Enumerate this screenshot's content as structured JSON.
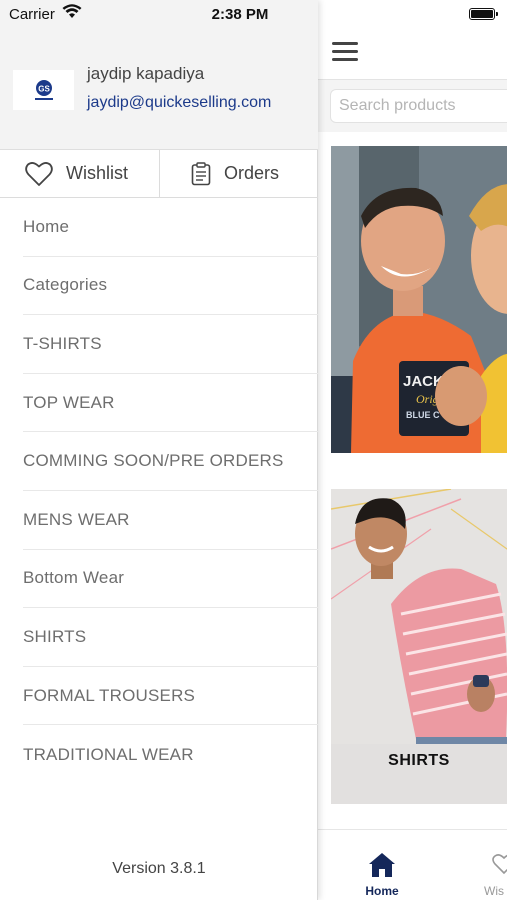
{
  "status_bar": {
    "carrier": "Carrier",
    "time": "2:38 PM",
    "wifi_icon": "wifi-icon",
    "battery_icon": "battery-icon"
  },
  "drawer": {
    "profile": {
      "name": "jaydip kapadiya",
      "email": "jaydip@quickeselling.com",
      "logo_icon": "brand-logo"
    },
    "quick_actions": {
      "wishlist_label": "Wishlist",
      "wishlist_icon": "heart-icon",
      "orders_label": "Orders",
      "orders_icon": "clipboard-icon"
    },
    "menu": [
      {
        "label": "Home"
      },
      {
        "label": "Categories"
      },
      {
        "label": "T-SHIRTS"
      },
      {
        "label": "TOP WEAR"
      },
      {
        "label": "COMMING SOON/PRE ORDERS"
      },
      {
        "label": "MENS WEAR"
      },
      {
        "label": "Bottom Wear"
      },
      {
        "label": "SHIRTS"
      },
      {
        "label": "FORMAL TROUSERS"
      },
      {
        "label": "TRADITIONAL WEAR"
      }
    ],
    "version": "Version 3.8.1"
  },
  "main": {
    "menu_icon": "hamburger-icon",
    "search": {
      "placeholder": "Search products",
      "value": ""
    },
    "banners": [
      {
        "label": ""
      },
      {
        "label": "SHIRTS"
      }
    ],
    "bottom_nav": [
      {
        "label": "Home",
        "icon": "home-icon",
        "active": true
      },
      {
        "label": "Wis",
        "icon": "heart-icon",
        "active": false
      }
    ]
  },
  "colors": {
    "accent": "#14275a",
    "email": "#1c3a8a",
    "menu_text": "#6e6e6e",
    "drawer_header_bg": "#f3f3f3"
  }
}
